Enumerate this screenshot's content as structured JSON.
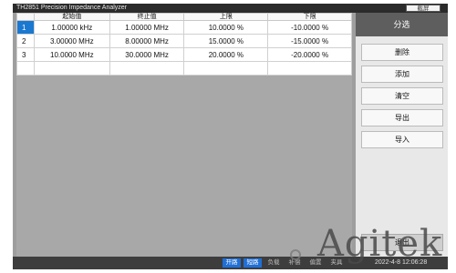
{
  "window": {
    "title": "TH2851 Precision Impedance Analyzer",
    "screenshot_label": "截屏"
  },
  "table": {
    "columns": [
      "",
      "起始值",
      "终止值",
      "上限",
      "下限"
    ],
    "rows": [
      {
        "index": "1",
        "start": "1.00000 kHz",
        "stop": "1.00000 MHz",
        "upper": "10.0000 %",
        "lower": "-10.0000 %",
        "selected": true
      },
      {
        "index": "2",
        "start": "3.00000 MHz",
        "stop": "8.00000 MHz",
        "upper": "15.0000 %",
        "lower": "-15.0000 %",
        "selected": false
      },
      {
        "index": "3",
        "start": "10.0000 MHz",
        "stop": "30.0000 MHz",
        "upper": "20.0000 %",
        "lower": "-20.0000 %",
        "selected": false
      }
    ]
  },
  "sidebar": {
    "title": "分选",
    "buttons": [
      "删除",
      "添加",
      "清空",
      "导出",
      "导入"
    ],
    "exit_label": "退出"
  },
  "statusbar": {
    "items": [
      {
        "label": "开路",
        "active": true
      },
      {
        "label": "短路",
        "active": true
      },
      {
        "label": "负载",
        "active": false
      },
      {
        "label": "补偿",
        "active": false
      },
      {
        "label": "偏置",
        "active": false
      },
      {
        "label": "夹具",
        "active": false
      }
    ],
    "time": "2022-4-8 12:06:28"
  },
  "watermark": {
    "brand": "Agitek"
  },
  "colors": {
    "accent": "#1b78d0",
    "status_active": "#1f6fd6"
  }
}
